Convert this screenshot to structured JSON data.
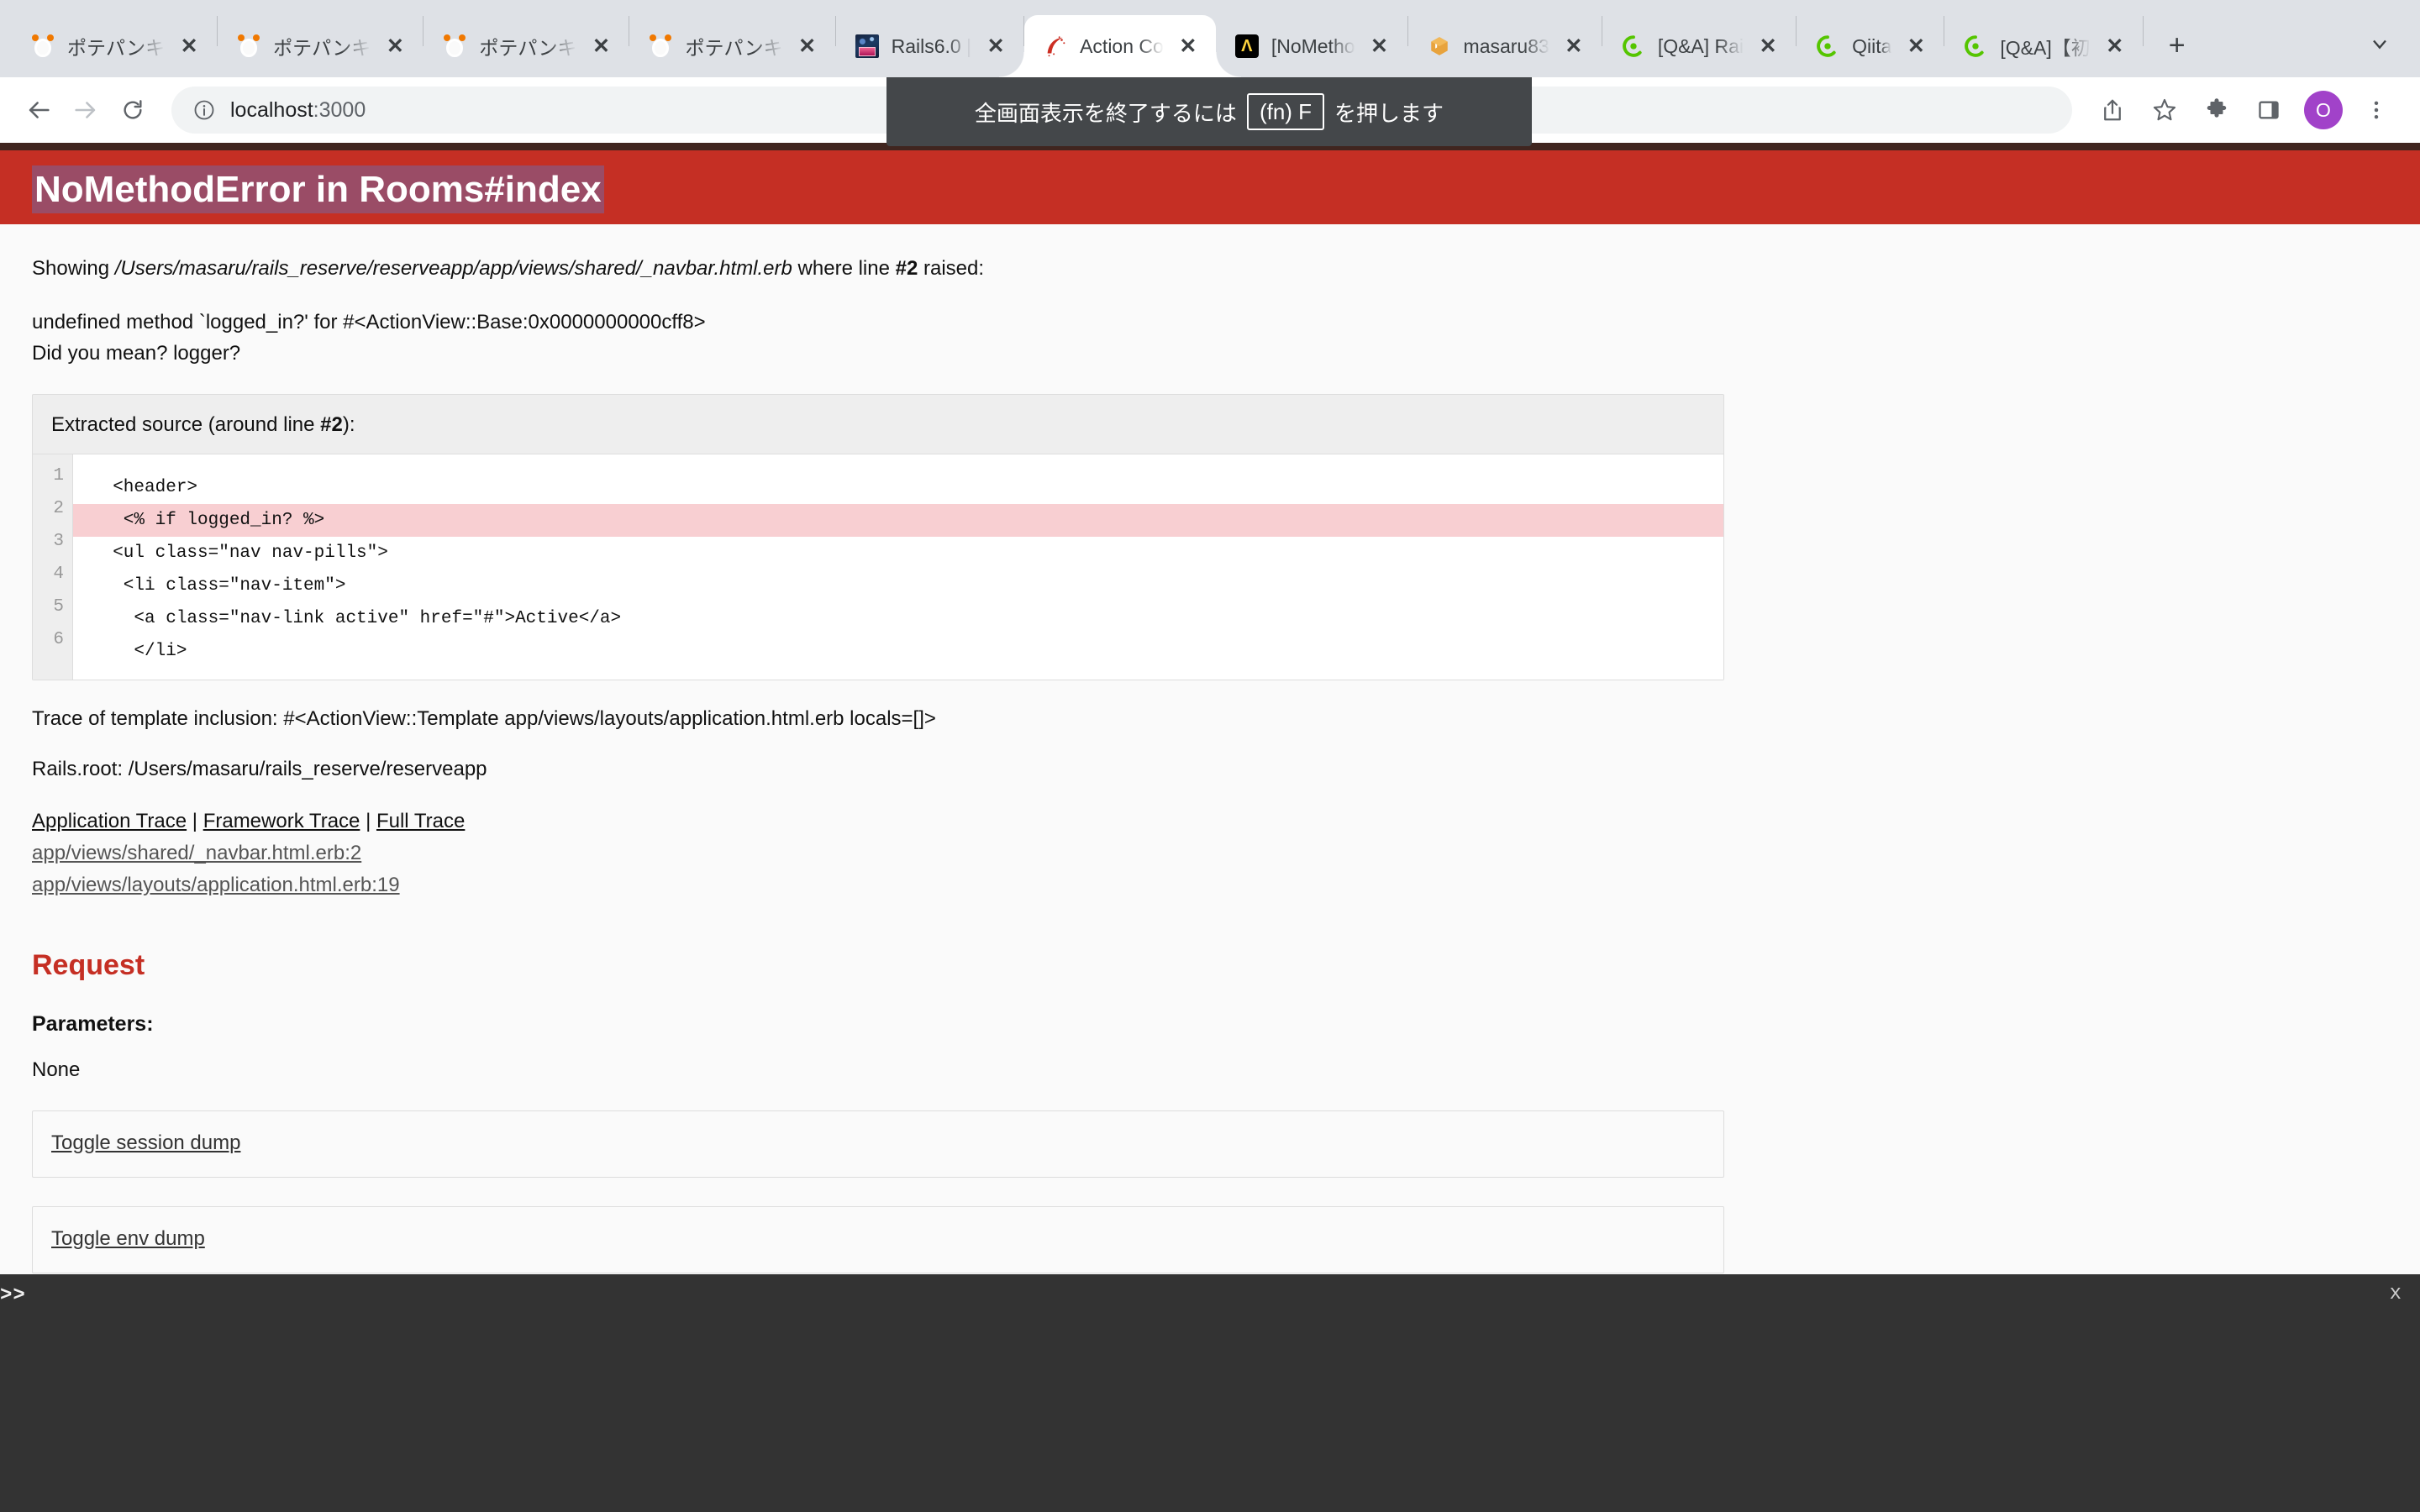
{
  "browser": {
    "tabs": [
      {
        "title": "ポテパンキ",
        "favicon": "potepan-icon",
        "active": false
      },
      {
        "title": "ポテパンキ",
        "favicon": "potepan-icon",
        "active": false
      },
      {
        "title": "ポテパンキ",
        "favicon": "potepan-icon",
        "active": false
      },
      {
        "title": "ポテパンキ",
        "favicon": "potepan-icon",
        "active": false
      },
      {
        "title": "Rails6.0 |",
        "favicon": "rails-photo-icon",
        "active": false
      },
      {
        "title": "Action Co",
        "favicon": "rails-logo-icon",
        "active": true
      },
      {
        "title": "[NoMetho",
        "favicon": "dark-square-icon",
        "active": false
      },
      {
        "title": "masaru83",
        "favicon": "orange-box-icon",
        "active": false
      },
      {
        "title": "[Q&A] Rai",
        "favicon": "qiita-icon",
        "active": false
      },
      {
        "title": "Qiita",
        "favicon": "qiita-icon",
        "active": false
      },
      {
        "title": "[Q&A]【初",
        "favicon": "qiita-icon",
        "active": false
      }
    ],
    "new_tab_label": "+",
    "tab_close_label": "✕",
    "toolbar": {
      "back_label": "←",
      "forward_label": "→",
      "reload_label": "⟳",
      "url": "localhost",
      "url_suffix": ":3000",
      "info_label": "ⓘ",
      "share_label": "share-icon",
      "bookmark_label": "star-icon",
      "extensions_label": "puzzle-icon",
      "sidepanel_label": "side-panel-icon",
      "avatar_initial": "O",
      "menu_label": "⋮"
    },
    "fullscreen_toast": {
      "prefix": "全画面表示を終了するには",
      "key": "(fn) F",
      "suffix": "を押します"
    }
  },
  "error_page": {
    "title": "NoMethodError in Rooms#index",
    "showing": {
      "prefix": "Showing ",
      "path": "/Users/masaru/rails_reserve/reserveapp/app/views/shared/_navbar.html.erb",
      "middle": " where line ",
      "line": "#2",
      "suffix": " raised:"
    },
    "exception_message": "undefined method `logged_in?' for #<ActionView::Base:0x0000000000cff8>",
    "did_you_mean": "Did you mean?  logger?",
    "extracted_source": {
      "heading_prefix": "Extracted source (around line ",
      "heading_line": "#2",
      "heading_suffix": "):",
      "lines": [
        {
          "no": "1",
          "code": "  <header>",
          "highlight": false
        },
        {
          "no": "2",
          "code": "   <% if logged_in? %>",
          "highlight": true
        },
        {
          "no": "3",
          "code": "  <ul class=\"nav nav-pills\">",
          "highlight": false
        },
        {
          "no": "4",
          "code": "   <li class=\"nav-item\">",
          "highlight": false
        },
        {
          "no": "5",
          "code": "    <a class=\"nav-link active\" href=\"#\">Active</a>",
          "highlight": false
        },
        {
          "no": "6",
          "code": "    </li>",
          "highlight": false
        }
      ]
    },
    "trace_of_template": "Trace of template inclusion: #<ActionView::Template app/views/layouts/application.html.erb locals=[]>",
    "rails_root": "Rails.root: /Users/masaru/rails_reserve/reserveapp",
    "trace_tabs": [
      {
        "label": "Application Trace"
      },
      {
        "label": "Framework Trace"
      },
      {
        "label": "Full Trace"
      }
    ],
    "trace_separator": "|",
    "trace_files": [
      "app/views/shared/_navbar.html.erb:2",
      "app/views/layouts/application.html.erb:19"
    ],
    "request_heading": "Request",
    "parameters_label": "Parameters",
    "parameters_colon": ":",
    "parameters_value": "None",
    "toggles": [
      {
        "label": "Toggle session dump"
      },
      {
        "label": "Toggle env dump"
      }
    ]
  },
  "web_console": {
    "prompt": ">>",
    "close_label": "x"
  },
  "colors": {
    "error_header_bg": "#C52F24",
    "error_header_border": "#40251f",
    "highlight_line": "#f8cfd2",
    "selection": "#80608f",
    "console_bg": "#333333",
    "tabstrip_bg": "#dee1e6",
    "avatar_bg": "#a142c9"
  }
}
